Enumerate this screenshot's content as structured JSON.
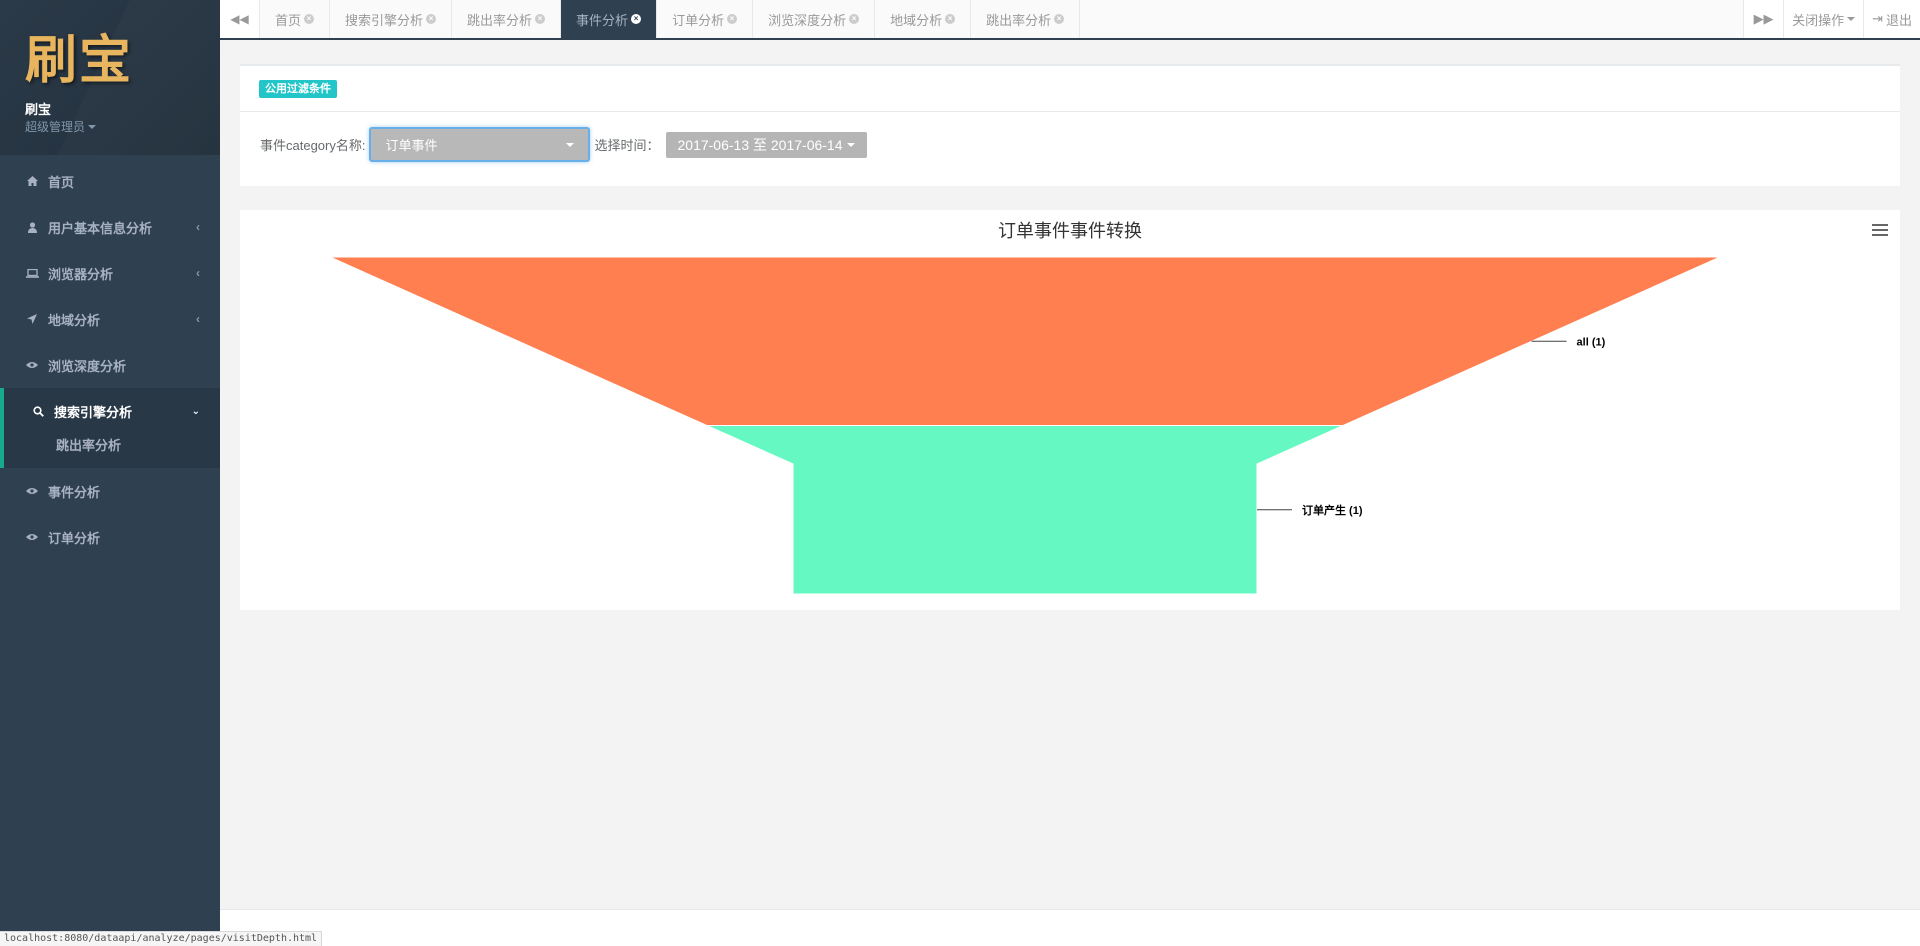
{
  "sidebar": {
    "logo": "刷宝",
    "user_name": "刷宝",
    "user_role": "超级管理员",
    "items": [
      {
        "label": "首页",
        "icon": "home-icon"
      },
      {
        "label": "用户基本信息分析",
        "icon": "user-icon"
      },
      {
        "label": "浏览器分析",
        "icon": "laptop-icon"
      },
      {
        "label": "地域分析",
        "icon": "location-arrow-icon"
      },
      {
        "label": "浏览深度分析",
        "icon": "eye-icon"
      },
      {
        "label": "搜索引擎分析",
        "icon": "search-icon"
      },
      {
        "label": "事件分析",
        "icon": "eye-icon"
      },
      {
        "label": "订单分析",
        "icon": "eye-icon"
      }
    ],
    "sub_items": [
      "跳出率分析"
    ]
  },
  "tabs": [
    {
      "label": "首页"
    },
    {
      "label": "搜索引擎分析"
    },
    {
      "label": "跳出率分析"
    },
    {
      "label": "事件分析",
      "active": true
    },
    {
      "label": "订单分析"
    },
    {
      "label": "浏览深度分析"
    },
    {
      "label": "地域分析"
    },
    {
      "label": "跳出率分析"
    }
  ],
  "tab_actions": {
    "close_ops": "关闭操作",
    "logout": "退出"
  },
  "filter": {
    "badge": "公用过滤条件",
    "category_label": "事件category名称:",
    "category_value": "订单事件",
    "time_label": "选择时间：",
    "time_value": "2017-06-13 至 2017-06-14"
  },
  "chart_data": {
    "type": "funnel",
    "title": "订单事件事件转换",
    "stages": [
      {
        "name": "all",
        "value": 1,
        "label": "all (1)",
        "color": "#ff7f50"
      },
      {
        "name": "订单产生",
        "value": 1,
        "label": "订单产生 (1)",
        "color": "#66f8c2"
      }
    ]
  },
  "status_url": "localhost:8080/dataapi/analyze/pages/visitDepth.html"
}
